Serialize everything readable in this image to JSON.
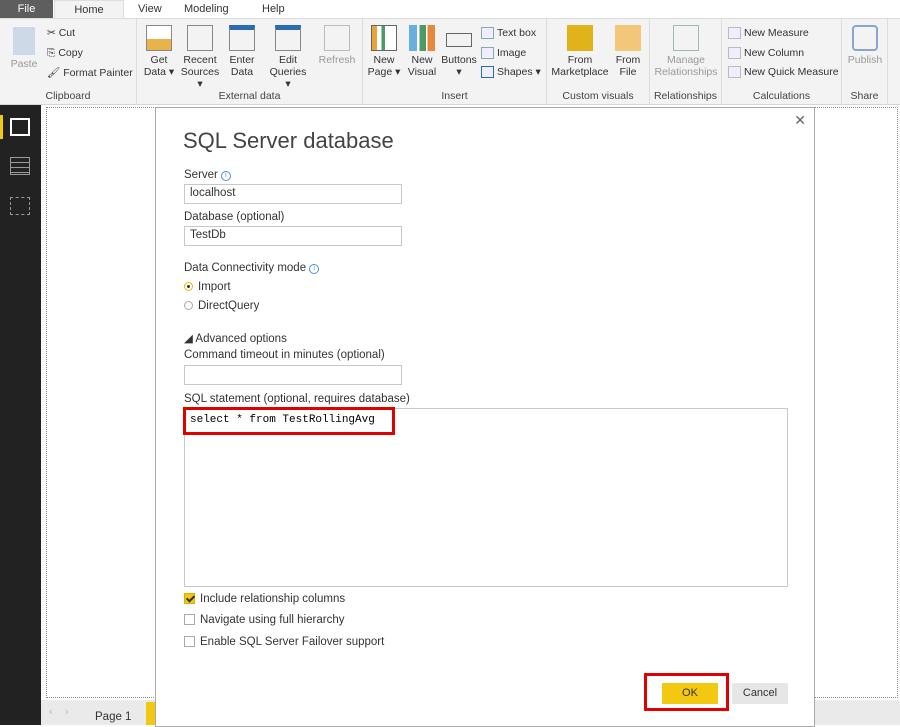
{
  "tabs": {
    "file": "File",
    "home": "Home",
    "view": "View",
    "modeling": "Modeling",
    "help": "Help"
  },
  "ribbon": {
    "clipboard": {
      "label": "Clipboard",
      "paste": "Paste",
      "cut": "Cut",
      "copy": "Copy",
      "format_painter": "Format Painter"
    },
    "external": {
      "label": "External data",
      "get_data": [
        "Get",
        "Data ▾"
      ],
      "recent": [
        "Recent",
        "Sources ▾"
      ],
      "enter": [
        "Enter",
        "Data"
      ],
      "edit": [
        "Edit",
        "Queries ▾"
      ],
      "refresh": "Refresh"
    },
    "insert": {
      "label": "Insert",
      "new_page": [
        "New",
        "Page ▾"
      ],
      "new_visual": [
        "New",
        "Visual"
      ],
      "buttons": [
        "Buttons",
        "▾"
      ],
      "text_box": "Text box",
      "image": "Image",
      "shapes": "Shapes ▾"
    },
    "custom": {
      "label": "Custom visuals",
      "marketplace": [
        "From",
        "Marketplace"
      ],
      "file": [
        "From",
        "File"
      ]
    },
    "relationships": {
      "label": "Relationships",
      "manage": [
        "Manage",
        "Relationships"
      ]
    },
    "calculations": {
      "label": "Calculations",
      "new_measure": "New Measure",
      "new_column": "New Column",
      "new_quick": "New Quick Measure"
    },
    "share": {
      "label": "Share",
      "publish": "Publish"
    }
  },
  "bottom": {
    "page": "Page 1"
  },
  "dialog": {
    "title": "SQL Server database",
    "server_label": "Server",
    "server_value": "localhost",
    "database_label": "Database (optional)",
    "database_value": "TestDb",
    "mode_label": "Data Connectivity mode",
    "import": "Import",
    "directquery": "DirectQuery",
    "advanced": "◢ Advanced options",
    "timeout_label": "Command timeout in minutes (optional)",
    "timeout_value": "",
    "sql_label": "SQL statement (optional, requires database)",
    "sql_value": "select * from TestRollingAvg",
    "include_rel": "Include relationship columns",
    "navigate": "Navigate using full hierarchy",
    "failover": "Enable SQL Server Failover support",
    "ok": "OK",
    "cancel": "Cancel",
    "close": "✕"
  },
  "colors": {
    "accent": "#f2c811",
    "highlight": "#e00000"
  }
}
